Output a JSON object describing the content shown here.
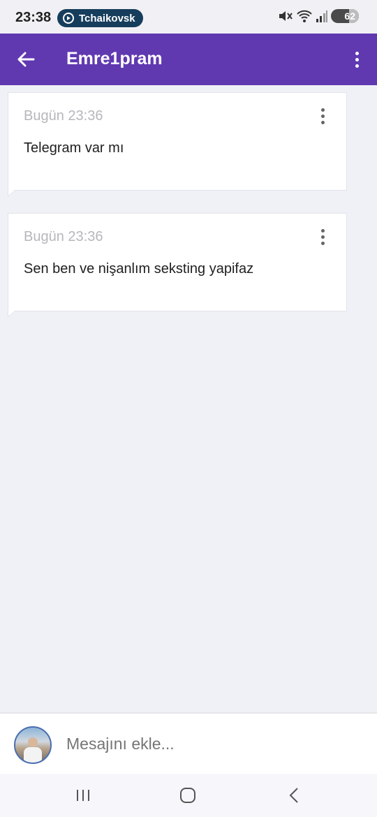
{
  "status_bar": {
    "time": "23:38",
    "media_pill_label": "Tchaikovsk",
    "battery_level": "62",
    "icons": [
      "mute-icon",
      "wifi-icon",
      "signal-icon",
      "battery-icon"
    ]
  },
  "app_bar": {
    "title": "Emre1pram",
    "back_icon": "arrow-left-icon",
    "menu_icon": "more-vert-icon",
    "color": "#6039b1"
  },
  "messages": [
    {
      "time": "Bugün 23:36",
      "text": "Telegram var mı"
    },
    {
      "time": "Bugün 23:36",
      "text": "Sen ben ve nişanlım seksting yapifaz"
    }
  ],
  "composer": {
    "placeholder": "Mesajını ekle..."
  },
  "nav_bar": {
    "buttons": [
      "recent-apps-icon",
      "home-icon",
      "back-icon"
    ]
  },
  "colors": {
    "accent": "#6039b1",
    "background": "#f0f1f7",
    "card": "#ffffff",
    "timestamp": "#b6b6bd"
  }
}
